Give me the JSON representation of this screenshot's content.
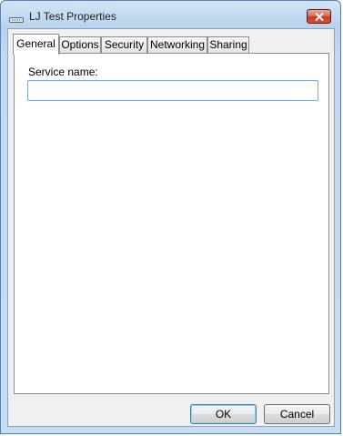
{
  "window": {
    "title": "LJ Test Properties",
    "icon": "network-adapter-icon",
    "close_icon": "close-icon"
  },
  "tabs": [
    {
      "label": "General",
      "active": true
    },
    {
      "label": "Options",
      "active": false
    },
    {
      "label": "Security",
      "active": false
    },
    {
      "label": "Networking",
      "active": false
    },
    {
      "label": "Sharing",
      "active": false
    }
  ],
  "general": {
    "service_name_label": "Service name:",
    "service_name_value": "",
    "service_name_placeholder": ""
  },
  "buttons": {
    "ok": "OK",
    "cancel": "Cancel"
  },
  "colors": {
    "close_button": "#c23b20",
    "frame": "#b9d1ec",
    "default_button_border": "#3c7fb1"
  }
}
